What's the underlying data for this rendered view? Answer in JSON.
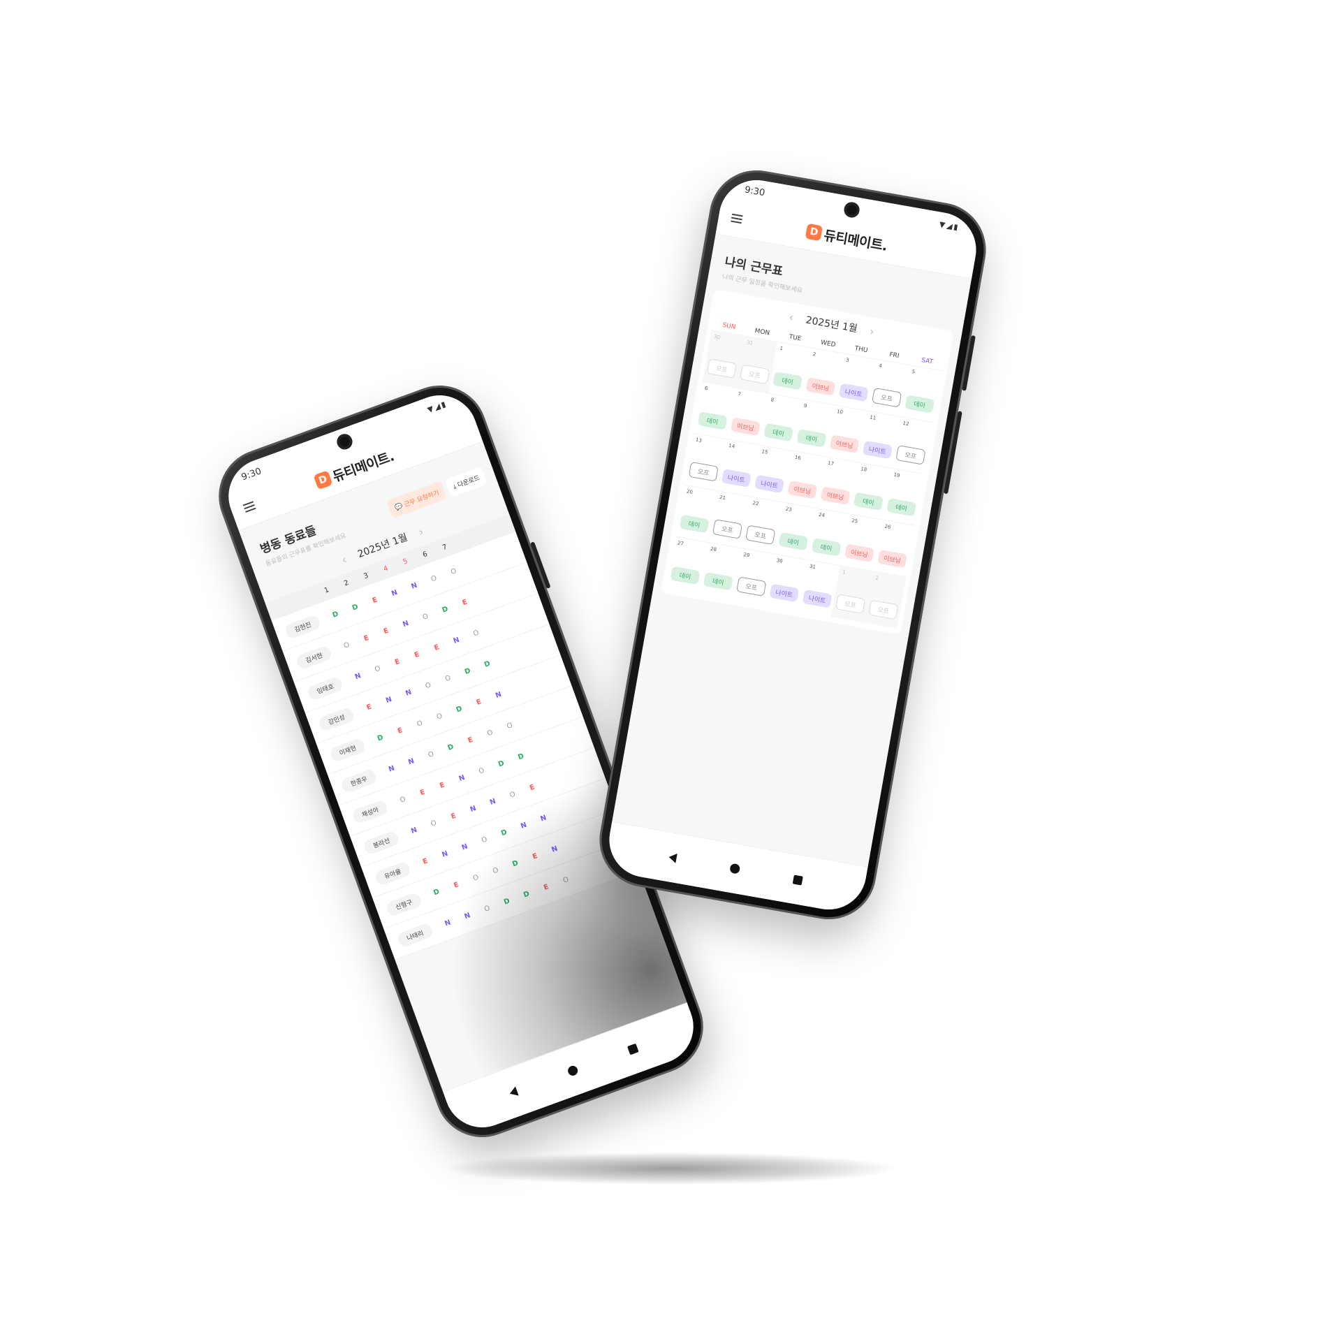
{
  "left_phone": {
    "status_time": "9:30",
    "status_icons": "▼◢▮",
    "brand_mark": "D",
    "brand_name": "듀티메이트.",
    "title": "병동 동료들",
    "subtitle": "동료들의 근무표를 확인해보세요",
    "request_button": "근무 요청하기",
    "download_button": "다운로드",
    "month_label": "2025년 1월",
    "day_headers": [
      "1",
      "2",
      "3",
      "4",
      "5",
      "6",
      "7"
    ],
    "rows": [
      {
        "name": "김현진",
        "shifts": [
          "D",
          "D",
          "E",
          "N",
          "N",
          "O",
          "O"
        ]
      },
      {
        "name": "김서현",
        "shifts": [
          "O",
          "E",
          "E",
          "N",
          "O",
          "D",
          "E"
        ]
      },
      {
        "name": "임태호",
        "shifts": [
          "N",
          "O",
          "E",
          "E",
          "E",
          "N",
          "O"
        ]
      },
      {
        "name": "강민성",
        "shifts": [
          "E",
          "N",
          "N",
          "O",
          "O",
          "D",
          "D"
        ]
      },
      {
        "name": "이재현",
        "shifts": [
          "D",
          "E",
          "O",
          "O",
          "D",
          "E",
          "N"
        ]
      },
      {
        "name": "한종우",
        "shifts": [
          "N",
          "N",
          "O",
          "D",
          "E",
          "O",
          "O"
        ]
      },
      {
        "name": "채성아",
        "shifts": [
          "O",
          "E",
          "E",
          "N",
          "O",
          "D",
          "D"
        ]
      },
      {
        "name": "봉라선",
        "shifts": [
          "N",
          "O",
          "E",
          "N",
          "N",
          "O",
          "E"
        ]
      },
      {
        "name": "유아율",
        "shifts": [
          "E",
          "N",
          "N",
          "O",
          "D",
          "N",
          "N"
        ]
      },
      {
        "name": "신형구",
        "shifts": [
          "D",
          "E",
          "O",
          "O",
          "D",
          "E",
          "N"
        ]
      },
      {
        "name": "나태리",
        "shifts": [
          "N",
          "N",
          "O",
          "D",
          "D",
          "E",
          "O"
        ]
      }
    ]
  },
  "right_phone": {
    "status_time": "9:30",
    "status_icons": "▼◢▮",
    "brand_mark": "D",
    "brand_name": "듀티메이트.",
    "title": "나의 근무표",
    "subtitle": "나의 근무 일정을 확인해보세요",
    "month_label": "2025년 1월",
    "weekdays": [
      "SUN",
      "MON",
      "TUE",
      "WED",
      "THU",
      "FRI",
      "SAT"
    ],
    "days": [
      {
        "d": "30",
        "label": "오프",
        "type": "off",
        "muted": true
      },
      {
        "d": "31",
        "label": "오프",
        "type": "off",
        "muted": true
      },
      {
        "d": "1",
        "label": "데이",
        "type": "day"
      },
      {
        "d": "2",
        "label": "이브닝",
        "type": "eve"
      },
      {
        "d": "3",
        "label": "나이트",
        "type": "night"
      },
      {
        "d": "4",
        "label": "오프",
        "type": "off"
      },
      {
        "d": "5",
        "label": "데이",
        "type": "day"
      },
      {
        "d": "6",
        "label": "데이",
        "type": "day"
      },
      {
        "d": "7",
        "label": "이브닝",
        "type": "eve"
      },
      {
        "d": "8",
        "label": "데이",
        "type": "day"
      },
      {
        "d": "9",
        "label": "데이",
        "type": "day"
      },
      {
        "d": "10",
        "label": "이브닝",
        "type": "eve"
      },
      {
        "d": "11",
        "label": "나이트",
        "type": "night"
      },
      {
        "d": "12",
        "label": "오프",
        "type": "off"
      },
      {
        "d": "13",
        "label": "오프",
        "type": "off"
      },
      {
        "d": "14",
        "label": "나이트",
        "type": "night"
      },
      {
        "d": "15",
        "label": "나이트",
        "type": "night"
      },
      {
        "d": "16",
        "label": "이브닝",
        "type": "eve"
      },
      {
        "d": "17",
        "label": "이브닝",
        "type": "eve"
      },
      {
        "d": "18",
        "label": "데이",
        "type": "day"
      },
      {
        "d": "19",
        "label": "데이",
        "type": "day"
      },
      {
        "d": "20",
        "label": "데이",
        "type": "day"
      },
      {
        "d": "21",
        "label": "오프",
        "type": "off"
      },
      {
        "d": "22",
        "label": "오프",
        "type": "off"
      },
      {
        "d": "23",
        "label": "데이",
        "type": "day"
      },
      {
        "d": "24",
        "label": "데이",
        "type": "day"
      },
      {
        "d": "25",
        "label": "이브닝",
        "type": "eve"
      },
      {
        "d": "26",
        "label": "이브닝",
        "type": "eve"
      },
      {
        "d": "27",
        "label": "데이",
        "type": "day"
      },
      {
        "d": "28",
        "label": "데이",
        "type": "day"
      },
      {
        "d": "29",
        "label": "오프",
        "type": "off"
      },
      {
        "d": "30",
        "label": "나이트",
        "type": "night"
      },
      {
        "d": "31",
        "label": "나이트",
        "type": "night"
      },
      {
        "d": "1",
        "label": "오프",
        "type": "off",
        "muted": true
      },
      {
        "d": "2",
        "label": "오프",
        "type": "off",
        "muted": true
      }
    ]
  },
  "colors": {
    "brand": "#ff7a45",
    "day": "#2fae63",
    "evening": "#ff5a5a",
    "night": "#7a5af8",
    "off": "#999999"
  }
}
